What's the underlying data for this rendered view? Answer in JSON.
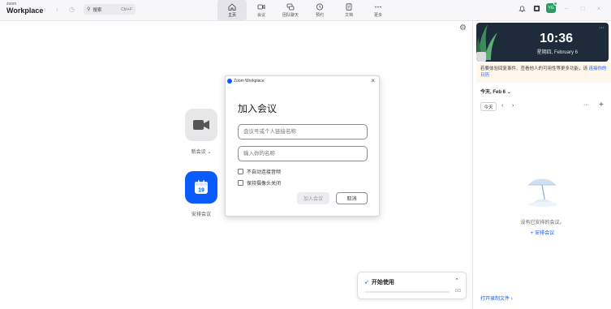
{
  "app": {
    "brand_small": "zoom",
    "brand_big": "Workplace"
  },
  "search": {
    "label": "搜索",
    "shortcut": "Ctrl+F"
  },
  "tabs": [
    {
      "label": "主页",
      "icon": "home-icon",
      "active": true
    },
    {
      "label": "会议",
      "icon": "video-camera-icon",
      "active": false
    },
    {
      "label": "团队聊天",
      "icon": "chat-bubbles-icon",
      "active": false
    },
    {
      "label": "预约",
      "icon": "clock-icon",
      "active": false
    },
    {
      "label": "文档",
      "icon": "document-icon",
      "active": false
    },
    {
      "label": "更多",
      "icon": "ellipsis-icon",
      "active": false
    }
  ],
  "user": {
    "initials": "YG"
  },
  "main": {
    "new_meeting_label": "新会议",
    "schedule_label": "安排会议",
    "calendar_day": "19"
  },
  "calendar_panel": {
    "time": "10:36",
    "date": "星期四, February 6",
    "banner_text": "若要体验回复事件、查看他人的可用性等更多功能，请",
    "banner_link": "连接你的日历",
    "today_label": "今天, Feb 6",
    "today_button": "今天",
    "empty_text": "没有已安排的会议。",
    "schedule_link": "+ 安排会议",
    "recordings_link": "打开录制文件"
  },
  "dialog": {
    "window_title": "Zoom Workplace",
    "heading": "加入会议",
    "meeting_id_placeholder": "会议号或个人链接名称",
    "name_placeholder": "输入你的名称",
    "option_no_audio": "不自动连接音频",
    "option_video_off": "保持摄像头关闭",
    "join_button": "加入会议",
    "cancel_button": "取消"
  },
  "getting_started": {
    "title": "开始使用",
    "progress_text": "0/3",
    "progress_fraction": 0
  },
  "colors": {
    "accent": "#0b5cff",
    "clock_bg": "#1d2b3a",
    "banner_bg": "#fff6ec",
    "avatar": "#2b9c61"
  }
}
